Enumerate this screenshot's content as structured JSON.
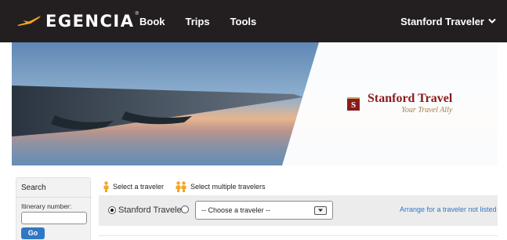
{
  "header": {
    "logo_text": "EGENCIA",
    "logo_trademark": "®",
    "nav": [
      {
        "label": "Book"
      },
      {
        "label": "Trips"
      },
      {
        "label": "Tools"
      }
    ],
    "user_label": "Stanford Traveler",
    "user_menu_icon": "chevron-down-icon"
  },
  "banner": {
    "brand_icon_letter": "S",
    "brand_name": "Stanford Travel",
    "brand_tagline": "Your Travel Ally"
  },
  "search": {
    "title": "Search",
    "itinerary_label": "Itinerary number:",
    "itinerary_value": "",
    "go_label": "Go"
  },
  "tabs": [
    {
      "label": "Select a traveler",
      "icon": "person-icon",
      "active": true
    },
    {
      "label": "Select multiple travelers",
      "icon": "people-icon",
      "active": false
    }
  ],
  "traveler_select": {
    "self_option_label": "Stanford Traveler",
    "self_option_checked": true,
    "other_option_checked": false,
    "dropdown_value": "-- Choose a traveler --",
    "arrange_link": "Arrange for a traveler not listed"
  },
  "colors": {
    "topbar": "#231f20",
    "logo_accent": "#f5a623",
    "link": "#2f78c4",
    "brand_red": "#8b1b1b",
    "brand_gold": "#a07d3e",
    "person_icon": "#f5a623"
  }
}
